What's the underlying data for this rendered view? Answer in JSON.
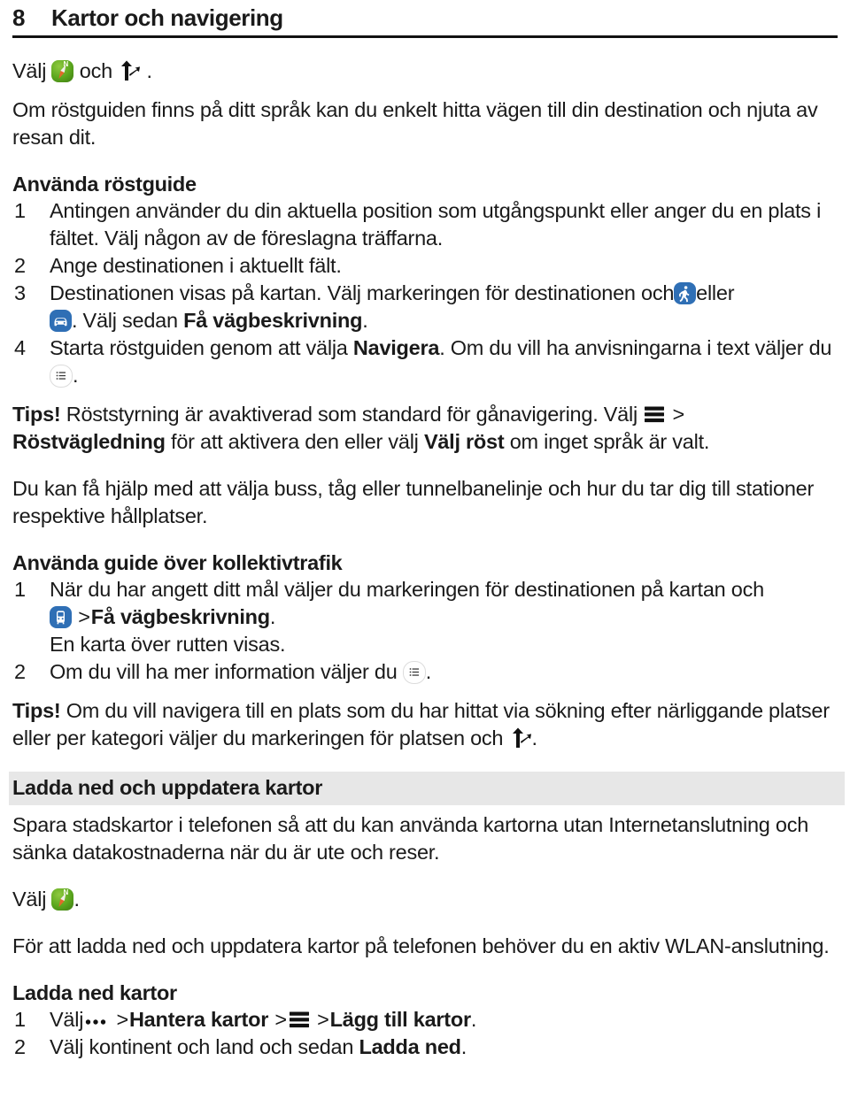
{
  "header": {
    "page_number": "8",
    "chapter_title": "Kartor och navigering"
  },
  "icons": {
    "compass": "compass-maps-icon",
    "navigate": "navigate-arrow-icon",
    "pedestrian": "pedestrian-walk-icon",
    "vehicle": "car-drive-icon",
    "bus": "bus-transit-icon",
    "list": "list-view-icon",
    "menu": "hamburger-menu-icon",
    "more": "more-dots-icon"
  },
  "body": {
    "select_label": "Välj",
    "and_label": "och",
    "period": ".",
    "intro_paragraph": "Om röstguiden finns på ditt språk kan du enkelt hitta vägen till din destination och njuta av resan dit.",
    "voice_guide": {
      "heading": "Använda röstguide",
      "item1_num": "1",
      "item1_text": "Antingen använder du din aktuella position som utgångspunkt eller anger du en plats i fältet. Välj någon av de föreslagna träffarna.",
      "item2_num": "2",
      "item2_text": "Ange destinationen i aktuellt fält.",
      "item3_num": "3",
      "item3_text_a": "Destinationen visas på kartan. Välj markeringen för destinationen och",
      "item3_text_b": "eller",
      "item3_text_c": ". Välj sedan",
      "item3_bold": "Få vägbeskrivning",
      "item3_text_d": ".",
      "item4_num": "4",
      "item4_text_a": "Starta röstguiden genom att välja",
      "item4_bold": "Navigera",
      "item4_text_b": ". Om du vill ha anvisningarna i text väljer du",
      "item4_text_c": "."
    },
    "tip1": {
      "label": "Tips!",
      "text_a": "Röststyrning är avaktiverad som standard för gånavigering. Välj",
      "separator": ">",
      "bold_a": "Röstvägledning",
      "text_b": "för att aktivera den eller välj",
      "bold_b": "Välj röst",
      "text_c": "om inget språk är valt."
    },
    "transit_paragraph": "Du kan få hjälp med att välja buss, tåg eller tunnelbanelinje och hur du tar dig till stationer respektive hållplatser.",
    "transit_guide": {
      "heading": "Använda guide över kollektivtrafik",
      "item1_num": "1",
      "item1_text_a": "När du har angett ditt mål väljer du markeringen för destinationen på kartan och",
      "item1_separator": ">",
      "item1_bold": "Få vägbeskrivning",
      "item1_text_b": ".",
      "item1_sub": "En karta över rutten visas.",
      "item2_num": "2",
      "item2_text_a": "Om du vill ha mer information väljer du",
      "item2_text_b": "."
    },
    "tip2": {
      "label": "Tips!",
      "text_a": "Om du vill navigera till en plats som du har hittat via sökning efter närliggande platser eller per kategori väljer du markeringen för platsen och",
      "text_b": "."
    },
    "download_section": {
      "heading": "Ladda ned och uppdatera kartor",
      "paragraph": "Spara stadskartor i telefonen så att du kan använda kartorna utan Internetanslutning och sänka datakostnaderna när du är ute och reser.",
      "select_label": "Välj",
      "select_period": ".",
      "wlan_paragraph": "För att ladda ned och uppdatera kartor på telefonen behöver du en aktiv WLAN-anslutning.",
      "sub_heading": "Ladda ned kartor",
      "item1_num": "1",
      "item1_select": "Välj",
      "item1_sep1": ">",
      "item1_bold1": "Hantera kartor",
      "item1_sep2": ">",
      "item1_sep3": ">",
      "item1_bold2": "Lägg till kartor",
      "item1_period": ".",
      "item2_num": "2",
      "item2_text_a": "Välj kontinent och land och sedan",
      "item2_bold": "Ladda ned",
      "item2_text_b": "."
    }
  },
  "colors": {
    "band": "#e7e7e7",
    "icon_blue": "#2f6fb5",
    "icon_green": "#5aa61d",
    "rule": "#111111"
  }
}
